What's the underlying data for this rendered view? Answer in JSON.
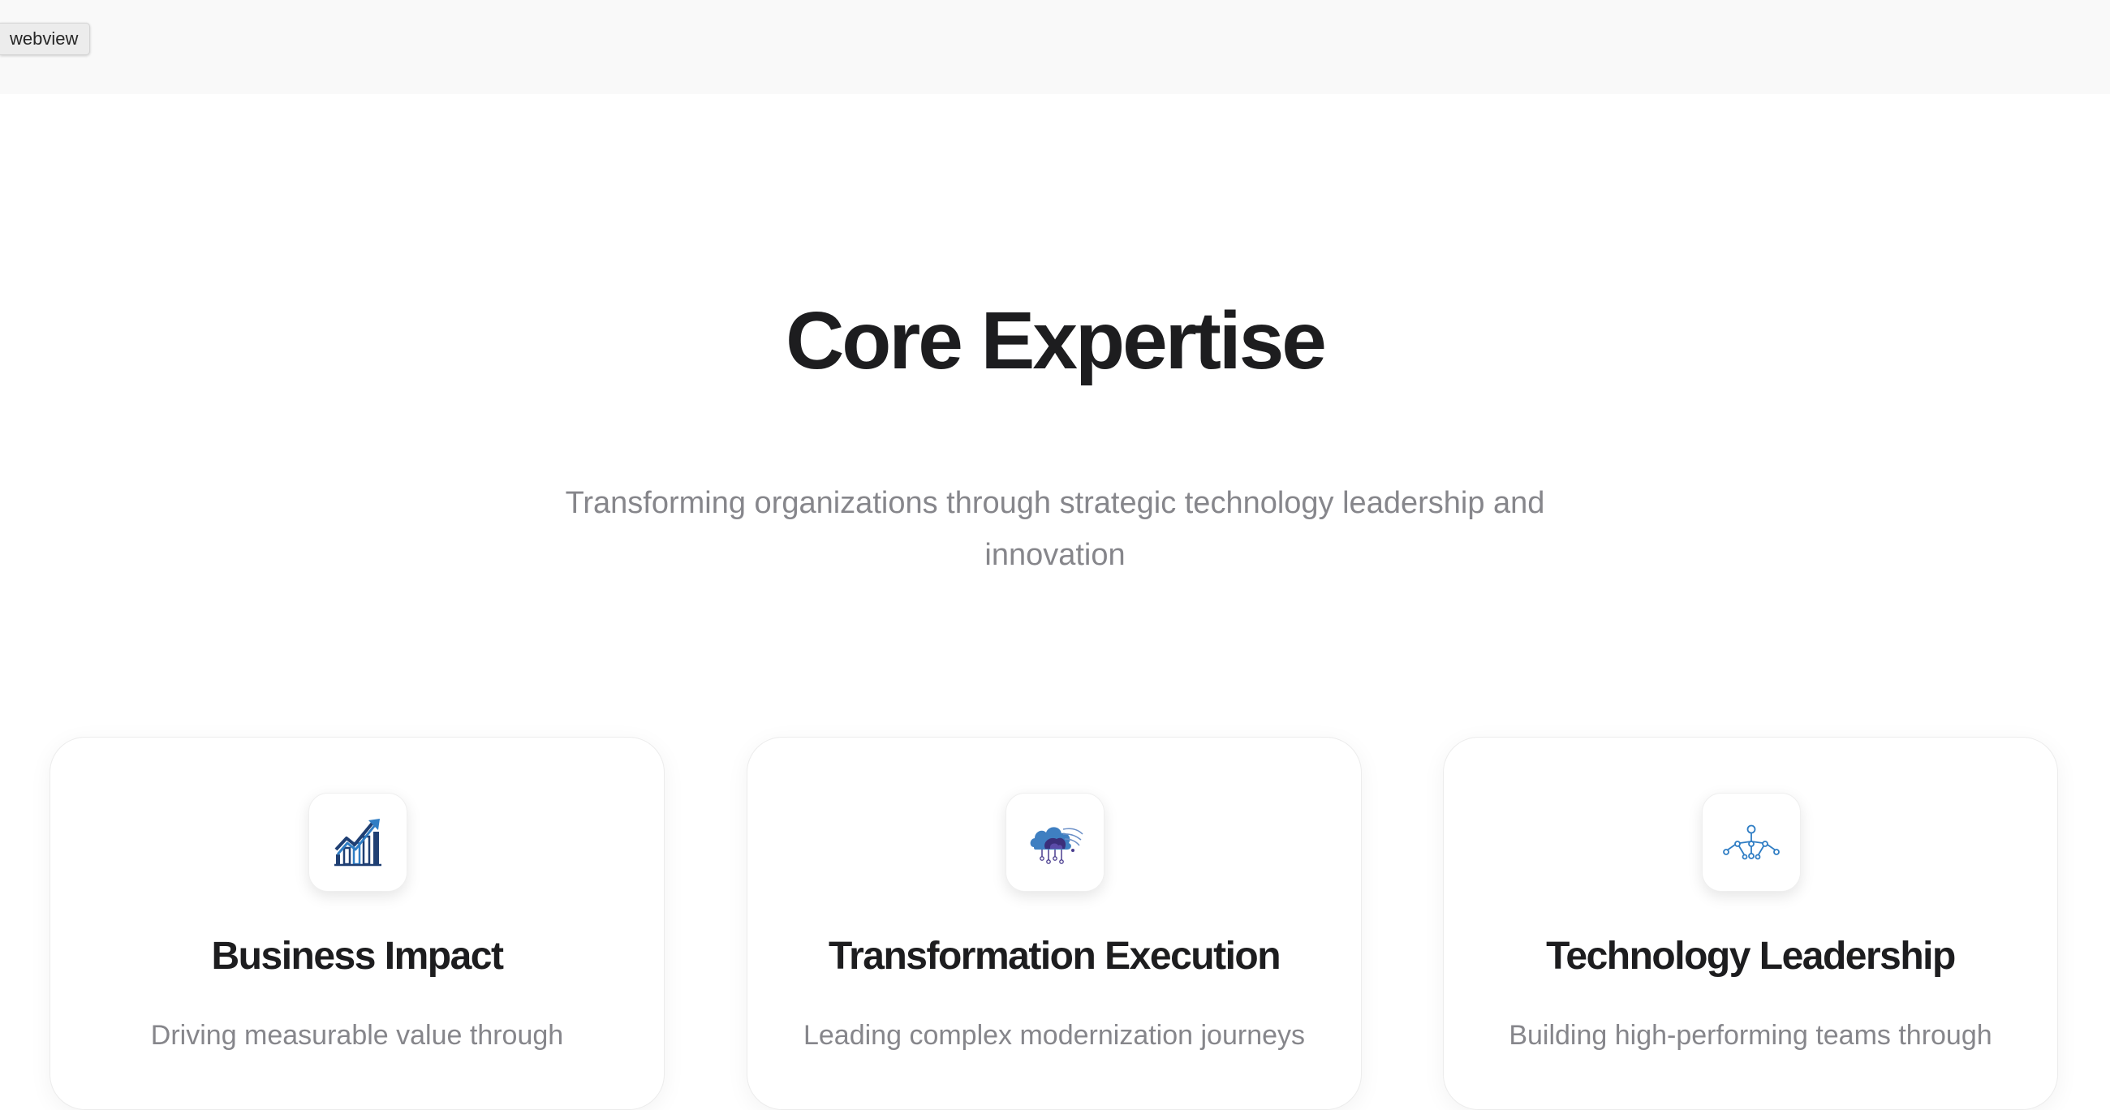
{
  "window": {
    "tag_label": "webview"
  },
  "section": {
    "title": "Core Expertise",
    "subtitle": "Transforming organizations through strategic technology leadership and innovation"
  },
  "cards": [
    {
      "icon": "growth-chart-icon",
      "title": "Business Impact",
      "description": "Driving measurable value through"
    },
    {
      "icon": "cloud-network-icon",
      "title": "Transformation Execution",
      "description": "Leading complex modernization journeys"
    },
    {
      "icon": "network-hierarchy-icon",
      "title": "Technology Leadership",
      "description": "Building high-performing teams through"
    }
  ],
  "colors": {
    "title": "#1d1d1f",
    "muted_text": "#86868b",
    "icon_blue": "#2f7dc4",
    "icon_navy": "#1f3f73",
    "icon_purple": "#4a3d8f",
    "topbar_bg": "#f9f9f9"
  }
}
